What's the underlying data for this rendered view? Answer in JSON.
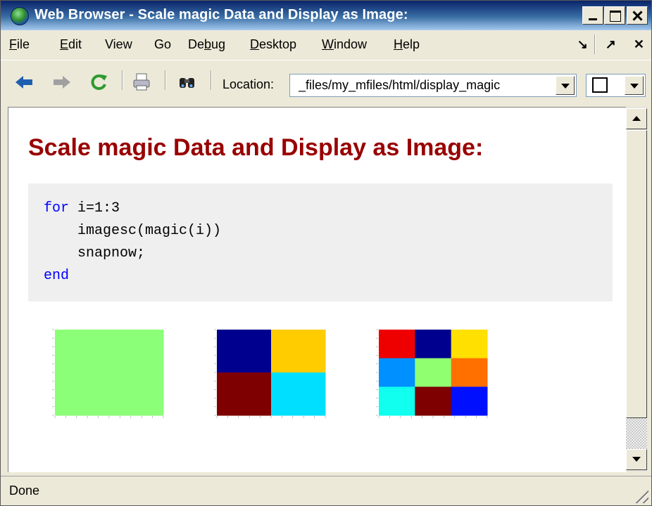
{
  "window": {
    "title": "Web Browser - Scale magic Data and Display as Image:"
  },
  "menu": {
    "items": [
      {
        "name": "file",
        "mnemonic": "F",
        "rest": "ile"
      },
      {
        "name": "edit",
        "mnemonic": "E",
        "rest": "dit"
      },
      {
        "name": "view",
        "mnemonic": "",
        "rest": "View"
      },
      {
        "name": "go",
        "mnemonic": "",
        "rest": "Go"
      },
      {
        "name": "debug",
        "pre": "De",
        "mnemonic": "b",
        "rest": "ug"
      },
      {
        "name": "desktop",
        "mnemonic": "D",
        "rest": "esktop"
      },
      {
        "name": "window",
        "mnemonic": "W",
        "rest": "indow"
      },
      {
        "name": "help",
        "mnemonic": "H",
        "rest": "elp"
      }
    ],
    "undock": "↘",
    "dock": "↗",
    "close": "✕"
  },
  "toolbar": {
    "location_label": "Location:",
    "location_value": "_files/my_mfiles/html/display_magic",
    "icons": [
      "back-icon",
      "forward-icon",
      "refresh-icon",
      "print-icon",
      "find-icon"
    ]
  },
  "page": {
    "title": "Scale magic Data and Display as Image:",
    "code": {
      "line1_kw": "for",
      "line1_rest": " i=1:3",
      "line2": "    imagesc(magic(i))",
      "line3": "    snapnow;",
      "line4_kw": "end"
    },
    "images": [
      {
        "grid": 1,
        "colors": [
          "#8cff78"
        ]
      },
      {
        "grid": 2,
        "colors": [
          "#00008f",
          "#ffcc00",
          "#7f0000",
          "#00dfff"
        ]
      },
      {
        "grid": 3,
        "colors": [
          "#ee0000",
          "#00008f",
          "#ffe000",
          "#0090ff",
          "#90ff70",
          "#ff7000",
          "#10ffee",
          "#7f0000",
          "#0010ff"
        ]
      }
    ]
  },
  "status": {
    "text": "Done"
  },
  "colors": {
    "heading": "#990000",
    "keyword": "#0000ff",
    "titlebar": "#0a246a"
  }
}
